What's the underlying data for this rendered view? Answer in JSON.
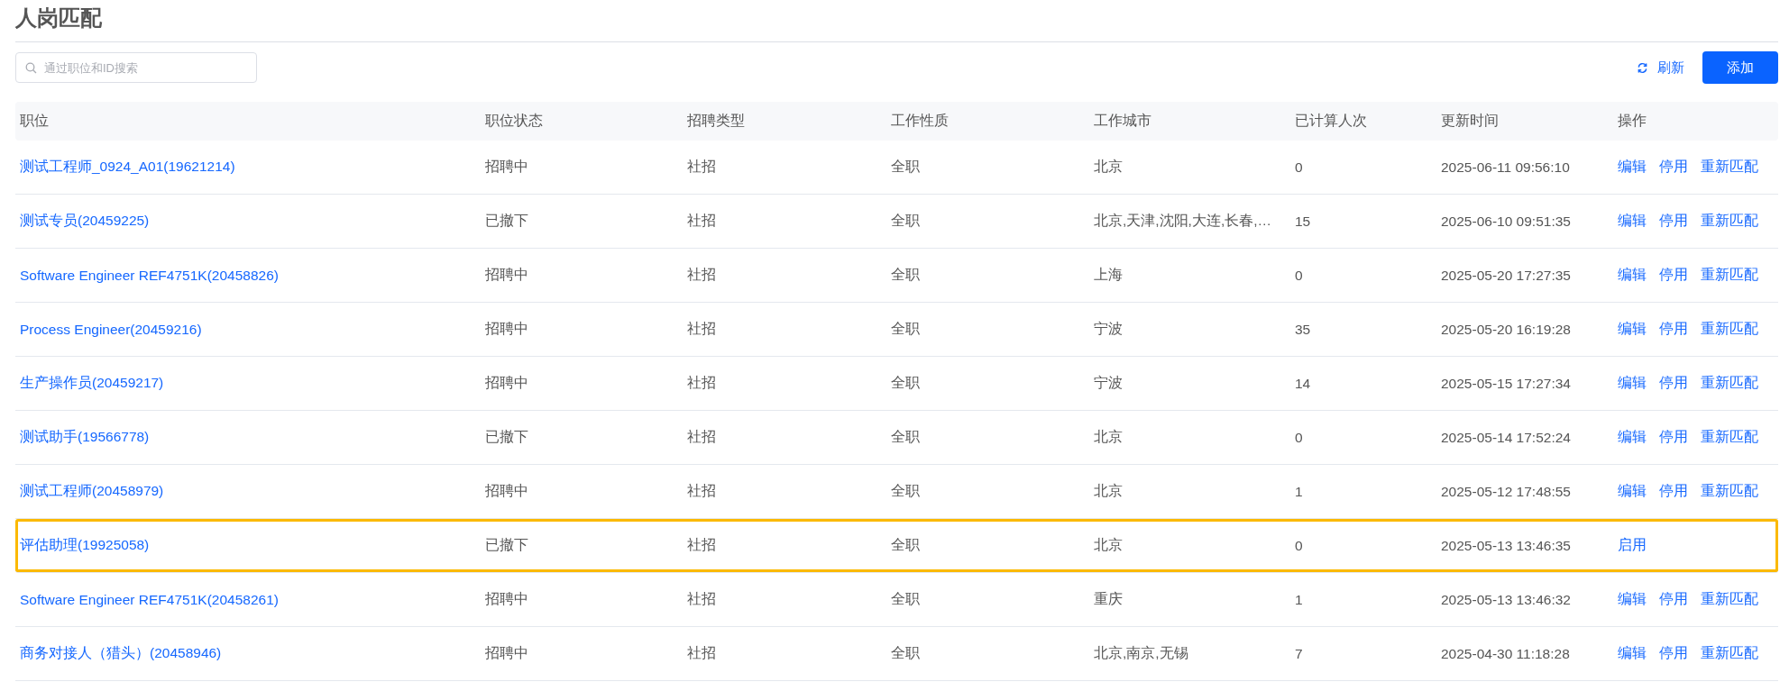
{
  "page_title": "人岗匹配",
  "search": {
    "placeholder": "通过职位和ID搜索"
  },
  "toolbar": {
    "refresh": "刷新",
    "add": "添加"
  },
  "table": {
    "columns": [
      "职位",
      "职位状态",
      "招聘类型",
      "工作性质",
      "工作城市",
      "已计算人次",
      "更新时间",
      "操作"
    ],
    "rows": [
      {
        "position": "测试工程师_0924_A01(19621214)",
        "status": "招聘中",
        "type": "社招",
        "nature": "全职",
        "city": "北京",
        "count": "0",
        "updated": "2025-06-11 09:56:10",
        "actions": [
          "编辑",
          "停用",
          "重新匹配"
        ],
        "selected": false
      },
      {
        "position": "测试专员(20459225)",
        "status": "已撤下",
        "type": "社招",
        "nature": "全职",
        "city": "北京,天津,沈阳,大连,长春,…",
        "count": "15",
        "updated": "2025-06-10 09:51:35",
        "actions": [
          "编辑",
          "停用",
          "重新匹配"
        ],
        "selected": false
      },
      {
        "position": "Software Engineer REF4751K(20458826)",
        "status": "招聘中",
        "type": "社招",
        "nature": "全职",
        "city": "上海",
        "count": "0",
        "updated": "2025-05-20 17:27:35",
        "actions": [
          "编辑",
          "停用",
          "重新匹配"
        ],
        "selected": false
      },
      {
        "position": "Process Engineer(20459216)",
        "status": "招聘中",
        "type": "社招",
        "nature": "全职",
        "city": "宁波",
        "count": "35",
        "updated": "2025-05-20 16:19:28",
        "actions": [
          "编辑",
          "停用",
          "重新匹配"
        ],
        "selected": false
      },
      {
        "position": "生产操作员(20459217)",
        "status": "招聘中",
        "type": "社招",
        "nature": "全职",
        "city": "宁波",
        "count": "14",
        "updated": "2025-05-15 17:27:34",
        "actions": [
          "编辑",
          "停用",
          "重新匹配"
        ],
        "selected": false
      },
      {
        "position": "测试助手(19566778)",
        "status": "已撤下",
        "type": "社招",
        "nature": "全职",
        "city": "北京",
        "count": "0",
        "updated": "2025-05-14 17:52:24",
        "actions": [
          "编辑",
          "停用",
          "重新匹配"
        ],
        "selected": false
      },
      {
        "position": "测试工程师(20458979)",
        "status": "招聘中",
        "type": "社招",
        "nature": "全职",
        "city": "北京",
        "count": "1",
        "updated": "2025-05-12 17:48:55",
        "actions": [
          "编辑",
          "停用",
          "重新匹配"
        ],
        "selected": false
      },
      {
        "position": "评估助理(19925058)",
        "status": "已撤下",
        "type": "社招",
        "nature": "全职",
        "city": "北京",
        "count": "0",
        "updated": "2025-05-13 13:46:35",
        "actions": [
          "启用"
        ],
        "selected": true
      },
      {
        "position": "Software Engineer REF4751K(20458261)",
        "status": "招聘中",
        "type": "社招",
        "nature": "全职",
        "city": "重庆",
        "count": "1",
        "updated": "2025-05-13 13:46:32",
        "actions": [
          "编辑",
          "停用",
          "重新匹配"
        ],
        "selected": false
      },
      {
        "position": "商务对接人（猎头）(20458946)",
        "status": "招聘中",
        "type": "社招",
        "nature": "全职",
        "city": "北京,南京,无锡",
        "count": "7",
        "updated": "2025-04-30 11:18:28",
        "actions": [
          "编辑",
          "停用",
          "重新匹配"
        ],
        "selected": false
      }
    ]
  }
}
